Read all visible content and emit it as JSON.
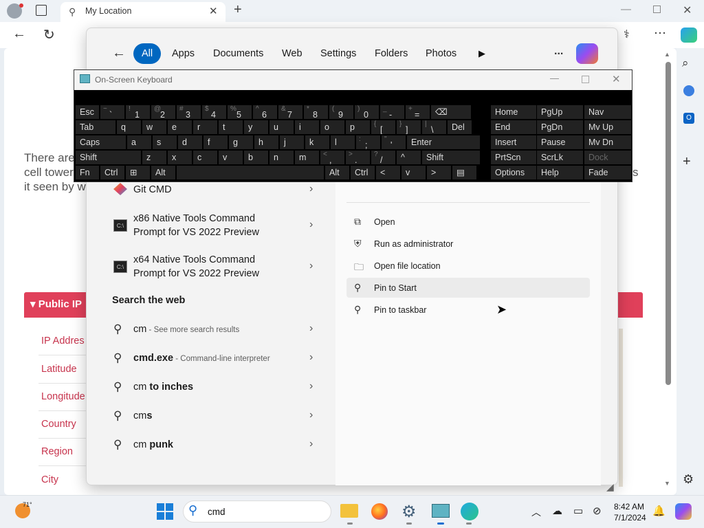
{
  "browser": {
    "tab_title": "My Location",
    "scroll_up": "▲",
    "scroll_down": "▼"
  },
  "page": {
    "text_lines": [
      "There are",
      "cell tower",
      "it seen by w"
    ],
    "right_fragment": "s",
    "section_title": "Public IP",
    "fields": [
      "IP Addres",
      "Latitude",
      "Longitude",
      "Country",
      "Region",
      "City"
    ]
  },
  "search": {
    "tabs": [
      "All",
      "Apps",
      "Documents",
      "Web",
      "Settings",
      "Folders",
      "Photos"
    ],
    "more_label": "...",
    "results": [
      {
        "name": "Git CMD"
      },
      {
        "line1": "x86 Native Tools Command",
        "line2": "Prompt for VS 2022 Preview"
      },
      {
        "line1": "x64 Native Tools Command",
        "line2": "Prompt for VS 2022 Preview"
      }
    ],
    "web_header": "Search the web",
    "web": [
      {
        "pre": "cm",
        "bold": "",
        "sub": " - See more search results"
      },
      {
        "pre": "",
        "bold": "cmd.exe",
        "sub": " - Command-line interpreter"
      },
      {
        "pre": "cm ",
        "bold": "to inches",
        "sub": ""
      },
      {
        "pre": "cm",
        "bold": "s",
        "sub": ""
      },
      {
        "pre": "cm ",
        "bold": "punk",
        "sub": ""
      }
    ],
    "actions": [
      "Open",
      "Run as administrator",
      "Open file location",
      "Pin to Start",
      "Pin to taskbar"
    ]
  },
  "osk": {
    "title": "On-Screen Keyboard",
    "rows": [
      [
        {
          "s": "",
          "m": "Esc"
        },
        {
          "s": "~",
          "m": "`"
        },
        {
          "s": "!",
          "m": "1"
        },
        {
          "s": "@",
          "m": "2"
        },
        {
          "s": "#",
          "m": "3"
        },
        {
          "s": "$",
          "m": "4"
        },
        {
          "s": "%",
          "m": "5"
        },
        {
          "s": "^",
          "m": "6"
        },
        {
          "s": "&",
          "m": "7"
        },
        {
          "s": "*",
          "m": "8"
        },
        {
          "s": "(",
          "m": "9"
        },
        {
          "s": ")",
          "m": "0"
        },
        {
          "s": "_",
          "m": "-"
        },
        {
          "s": "+",
          "m": "="
        },
        {
          "s": "",
          "m": "⌫"
        }
      ],
      [
        {
          "s": "",
          "m": "Tab"
        },
        {
          "s": "",
          "m": "q"
        },
        {
          "s": "",
          "m": "w"
        },
        {
          "s": "",
          "m": "e"
        },
        {
          "s": "",
          "m": "r"
        },
        {
          "s": "",
          "m": "t"
        },
        {
          "s": "",
          "m": "y"
        },
        {
          "s": "",
          "m": "u"
        },
        {
          "s": "",
          "m": "i"
        },
        {
          "s": "",
          "m": "o"
        },
        {
          "s": "",
          "m": "p"
        },
        {
          "s": "{",
          "m": "["
        },
        {
          "s": "}",
          "m": "]"
        },
        {
          "s": "|",
          "m": "\\"
        },
        {
          "s": "",
          "m": "Del"
        }
      ],
      [
        {
          "s": "",
          "m": "Caps"
        },
        {
          "s": "",
          "m": "a"
        },
        {
          "s": "",
          "m": "s"
        },
        {
          "s": "",
          "m": "d"
        },
        {
          "s": "",
          "m": "f"
        },
        {
          "s": "",
          "m": "g"
        },
        {
          "s": "",
          "m": "h"
        },
        {
          "s": "",
          "m": "j"
        },
        {
          "s": "",
          "m": "k"
        },
        {
          "s": "",
          "m": "l"
        },
        {
          "s": ":",
          "m": ";"
        },
        {
          "s": "\"",
          "m": "'"
        },
        {
          "s": "",
          "m": "Enter"
        }
      ],
      [
        {
          "s": "",
          "m": "Shift"
        },
        {
          "s": "",
          "m": "z"
        },
        {
          "s": "",
          "m": "x"
        },
        {
          "s": "",
          "m": "c"
        },
        {
          "s": "",
          "m": "v"
        },
        {
          "s": "",
          "m": "b"
        },
        {
          "s": "",
          "m": "n"
        },
        {
          "s": "",
          "m": "m"
        },
        {
          "s": "<",
          "m": ","
        },
        {
          "s": ">",
          "m": "."
        },
        {
          "s": "?",
          "m": "/"
        },
        {
          "s": "",
          "m": "^"
        },
        {
          "s": "",
          "m": "Shift"
        }
      ],
      [
        {
          "s": "",
          "m": "Fn"
        },
        {
          "s": "",
          "m": "Ctrl"
        },
        {
          "s": "",
          "m": "⊞"
        },
        {
          "s": "",
          "m": "Alt"
        },
        {
          "s": "",
          "m": ""
        },
        {
          "s": "",
          "m": "Alt"
        },
        {
          "s": "",
          "m": "Ctrl"
        },
        {
          "s": "",
          "m": "<"
        },
        {
          "s": "",
          "m": "v"
        },
        {
          "s": "",
          "m": ">"
        },
        {
          "s": "",
          "m": "▤"
        }
      ]
    ],
    "nav_cols": [
      [
        "Home",
        "End",
        "Insert",
        "PrtScn",
        "Options"
      ],
      [
        "PgUp",
        "PgDn",
        "Pause",
        "ScrLk",
        "Help"
      ],
      [
        "Nav",
        "Mv Up",
        "Mv Dn",
        "Dock",
        "Fade"
      ]
    ]
  },
  "taskbar": {
    "weather": "71°",
    "search_value": "cmd",
    "time": "8:42 AM",
    "date": "7/1/2024"
  }
}
